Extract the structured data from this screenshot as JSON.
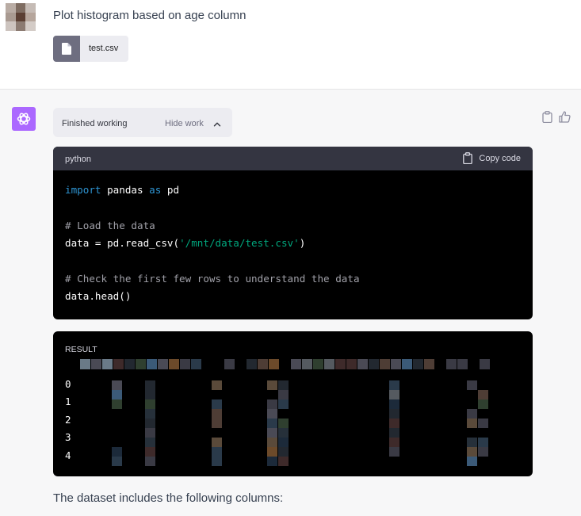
{
  "user_message": {
    "text": "Plot histogram based on age column",
    "attachment": {
      "name": "test.csv",
      "icon": "file-icon"
    },
    "avatar_colors": [
      "#b9aca4",
      "#7e6c61",
      "#c5bbb5",
      "#a99a91",
      "#5b3f33",
      "#b6a69c",
      "#cdc4bf",
      "#8c7b72",
      "#d4ccc7"
    ]
  },
  "assistant": {
    "avatar_icon": "openai-logo-icon",
    "work_status": "Finished working",
    "work_toggle": "Hide work",
    "code": {
      "language": "python",
      "copy_label": "Copy code",
      "lines": [
        [
          {
            "t": "import",
            "c": "kw"
          },
          {
            "t": " pandas ",
            "c": ""
          },
          {
            "t": "as",
            "c": "kw"
          },
          {
            "t": " pd",
            "c": ""
          }
        ],
        [],
        [
          {
            "t": "# Load the data",
            "c": "cm"
          }
        ],
        [
          {
            "t": "data = pd.read_csv(",
            "c": ""
          },
          {
            "t": "'/mnt/data/test.csv'",
            "c": "st"
          },
          {
            "t": ")",
            "c": ""
          }
        ],
        [],
        [
          {
            "t": "# Check the first few rows to understand the data",
            "c": "cm"
          }
        ],
        [
          {
            "t": "data.head()",
            "c": ""
          }
        ]
      ]
    },
    "result": {
      "title": "RESULT",
      "row_indices": [
        "0",
        "1",
        "2",
        "3",
        "4"
      ]
    },
    "followup_text": "The dataset includes the following columns:"
  },
  "colors": {
    "page_bg": "#f7f7f8",
    "code_bg": "#000000",
    "code_header_bg": "#343541",
    "keyword": "#2e95d3",
    "comment": "#a0a0a8",
    "string": "#00a67d",
    "assistant_avatar": "#ab68ff"
  }
}
